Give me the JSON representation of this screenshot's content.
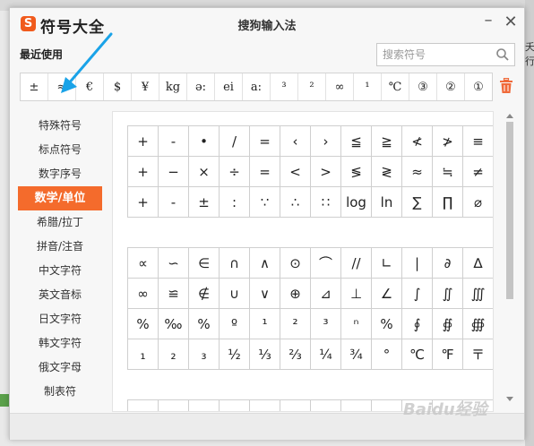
{
  "app": {
    "logo_letter": "S",
    "name": "符号大全",
    "window_title": "搜狗输入法",
    "minimize": "–",
    "close": "✕"
  },
  "recent": {
    "label": "最近使用",
    "items": [
      "±",
      "≈",
      "€",
      "$",
      "¥",
      "kg",
      "ə:",
      "ei",
      "a:",
      "³",
      "²",
      "∞",
      "¹",
      "℃",
      "③",
      "②",
      "①"
    ]
  },
  "search": {
    "placeholder": "搜索符号"
  },
  "nav": {
    "items": [
      "特殊符号",
      "标点符号",
      "数字序号",
      "数学/单位",
      "希腊/拉丁",
      "拼音/注音",
      "中文字符",
      "英文音标",
      "日文字符",
      "韩文字符",
      "俄文字母",
      "制表符"
    ],
    "active_index": 3
  },
  "grid1": {
    "rows": [
      [
        "+",
        "-",
        "•",
        "/",
        "=",
        "‹",
        "›",
        "≦",
        "≧",
        "≮",
        "≯",
        "≡"
      ],
      [
        "+",
        "−",
        "×",
        "÷",
        "=",
        "<",
        ">",
        "≶",
        "≷",
        "≈",
        "≒",
        "≠"
      ],
      [
        "+",
        "-",
        "±",
        ":",
        "∵",
        "∴",
        "∷",
        "log",
        "ln",
        "∑",
        "∏",
        "⌀"
      ]
    ]
  },
  "grid2": {
    "rows": [
      [
        "∝",
        "∽",
        "∈",
        "∩",
        "∧",
        "⊙",
        "⌒",
        "//",
        "∟",
        "|",
        "∂",
        "∆"
      ],
      [
        "∞",
        "≌",
        "∉",
        "∪",
        "∨",
        "⊕",
        "⊿",
        "⊥",
        "∠",
        "∫",
        "∬",
        "∭"
      ],
      [
        "%",
        "‰",
        "%",
        "º",
        "¹",
        "²",
        "³",
        "ⁿ",
        "%",
        "∮",
        "∯",
        "∰"
      ],
      [
        "₁",
        "₂",
        "₃",
        "½",
        "⅓",
        "⅔",
        "¼",
        "¾",
        "°",
        "℃",
        "℉",
        "〒"
      ]
    ]
  },
  "grid3": {
    "rows": [
      [
        "",
        "",
        "",
        "",
        "",
        "",
        "",
        "",
        "",
        "",
        "",
        ""
      ]
    ]
  },
  "background": {
    "right_edge_text": "夭行",
    "watermark": "Baidu经验"
  },
  "colors": {
    "accent": "#f46b2c",
    "logo": "#f05a1c",
    "annotation_arrow": "#1aa3e8"
  },
  "icons": {
    "search": "search-icon",
    "trash": "trash-icon"
  }
}
